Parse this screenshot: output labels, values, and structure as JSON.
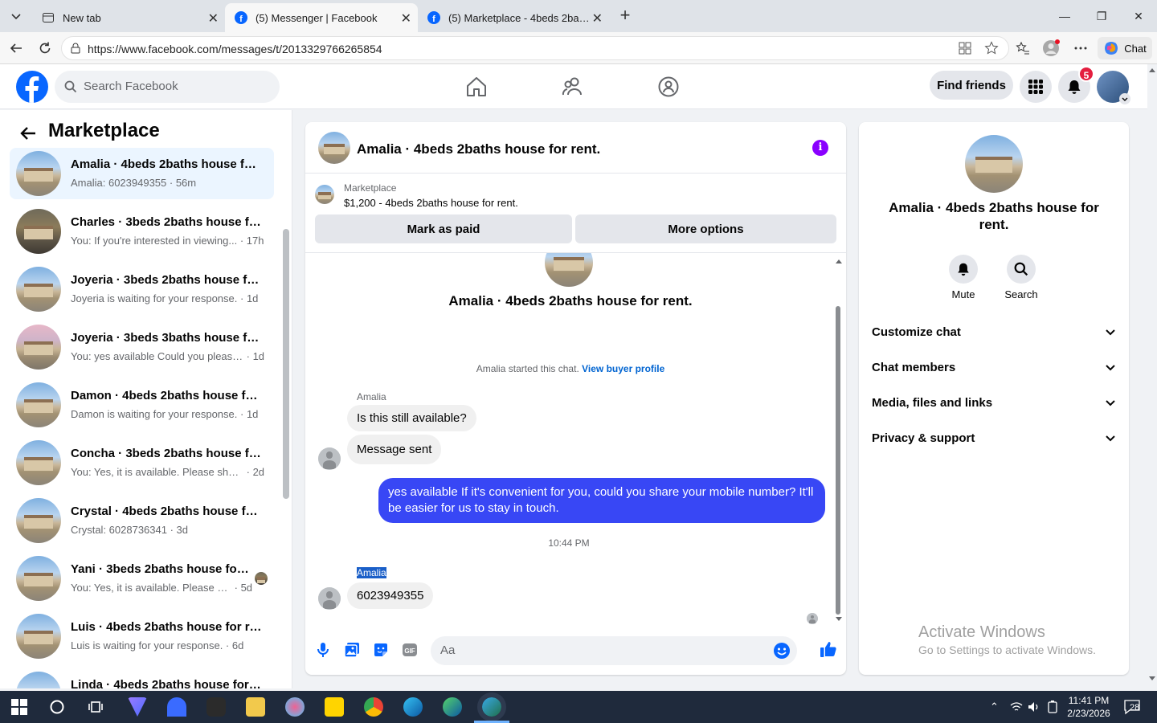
{
  "browser": {
    "tabs": [
      {
        "title": "New tab"
      },
      {
        "title": "(5) Messenger | Facebook"
      },
      {
        "title": "(5) Marketplace - 4beds 2baths house for rent"
      }
    ],
    "url": "https://www.facebook.com/messages/t/2013329766265854",
    "chat_label": "Chat"
  },
  "fb": {
    "search_placeholder": "Search Facebook",
    "find_friends": "Find friends",
    "notification_count": "5"
  },
  "sidebar": {
    "title": "Marketplace",
    "conversations": [
      {
        "name": "Amalia · 4beds 2baths house for rent.",
        "preview": "Amalia: 6023949355",
        "time": "56m",
        "thumb": "day"
      },
      {
        "name": "Charles · 3beds 2baths house for rent.",
        "preview": "You: If you're interested in viewing...",
        "time": "17h",
        "thumb": "dark"
      },
      {
        "name": "Joyeria · 3beds 2baths house for rent.",
        "preview": "Joyeria is waiting for your response.",
        "time": "1d",
        "thumb": "day"
      },
      {
        "name": "Joyeria · 3beds 3baths house for rent.",
        "preview": "You: yes available Could you please...",
        "time": "1d",
        "thumb": "dusk"
      },
      {
        "name": "Damon · 4beds 2baths house for rent.",
        "preview": "Damon is waiting for your response.",
        "time": "1d",
        "thumb": "day"
      },
      {
        "name": "Concha · 3beds 2baths house for rent.",
        "preview": "You: Yes, it is available. Please share...",
        "time": "2d",
        "thumb": "day"
      },
      {
        "name": "Crystal · 4beds 2baths house for rent.",
        "preview": "Crystal: 6028736341",
        "time": "3d",
        "thumb": "day"
      },
      {
        "name": "Yani · 3beds 2baths house for rent.",
        "preview": "You: Yes, it is available. Please sh...",
        "time": "5d",
        "thumb": "day"
      },
      {
        "name": "Luis · 4beds 2baths house for rent.",
        "preview": "Luis is waiting for your response.",
        "time": "6d",
        "thumb": "day"
      },
      {
        "name": "Linda · 4beds 2baths house for rent.",
        "preview": "",
        "time": "",
        "thumb": "day"
      }
    ]
  },
  "chat": {
    "title": "Amalia · 4beds 2baths house for rent.",
    "marketplace_label": "Marketplace",
    "listing": "$1,200 - 4beds 2baths house for rent.",
    "mark_paid": "Mark as paid",
    "more_options": "More options",
    "intro_title": "Amalia · 4beds 2baths house for rent.",
    "started_text": "Amalia started this chat.",
    "buyer_profile": "View buyer profile",
    "sender1": "Amalia",
    "msg1": "Is this still available?",
    "msg2": "Message sent",
    "msg_out": "yes available If it's convenient for you, could you share your mobile number? It'll be easier for us to stay in touch.",
    "timestamp": "10:44 PM",
    "sender2": "Amalia",
    "msg3": "6023949355",
    "composer_placeholder": "Aa"
  },
  "details": {
    "name": "Amalia · 4beds 2baths house for rent.",
    "mute": "Mute",
    "search": "Search",
    "sections": [
      "Customize chat",
      "Chat members",
      "Media, files and links",
      "Privacy & support"
    ]
  },
  "watermark": {
    "line1": "Activate Windows",
    "line2": "Go to Settings to activate Windows."
  },
  "taskbar": {
    "time": "11:41 PM",
    "date": "2/23/2026",
    "notif": "28"
  },
  "colors": {
    "fb_blue": "#0866ff",
    "outgoing_bubble": "#3847f5",
    "info_purple": "#8a00ff",
    "badge_red": "#e41e3f"
  }
}
